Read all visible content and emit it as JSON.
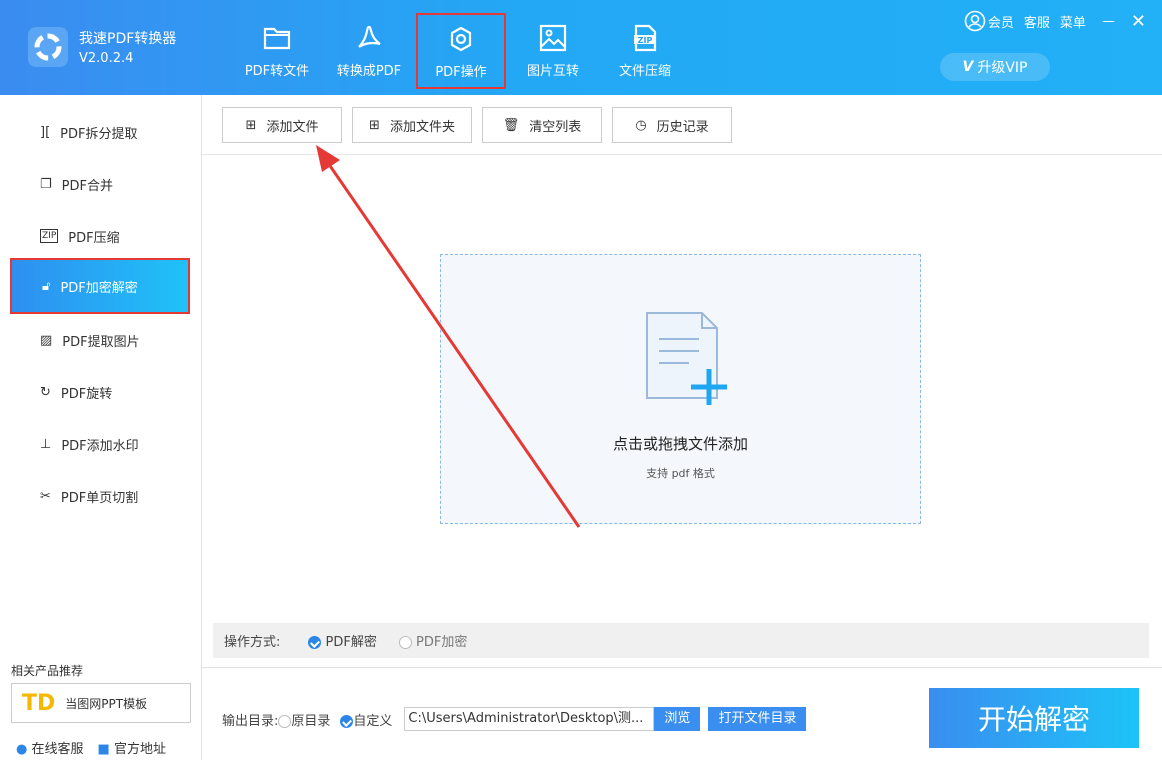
{
  "app": {
    "name": "我速PDF转换器",
    "version": "V2.0.2.4"
  },
  "nav": [
    {
      "label": "PDF转文件",
      "icon": "folder-icon"
    },
    {
      "label": "转换成PDF",
      "icon": "acrobat-icon"
    },
    {
      "label": "PDF操作",
      "icon": "gear-icon",
      "active": true
    },
    {
      "label": "图片互转",
      "icon": "image-icon"
    },
    {
      "label": "文件压缩",
      "icon": "zip-icon"
    }
  ],
  "top_right": {
    "member": "会员",
    "service": "客服",
    "menu": "菜单",
    "vip": "升级VIP"
  },
  "sidebar": {
    "items": [
      {
        "label": "PDF拆分提取"
      },
      {
        "label": "PDF合并"
      },
      {
        "label": "PDF压缩"
      },
      {
        "label": "PDF加密解密",
        "active": true
      },
      {
        "label": "PDF提取图片"
      },
      {
        "label": "PDF旋转"
      },
      {
        "label": "PDF添加水印"
      },
      {
        "label": "PDF单页切割"
      }
    ],
    "rec_title": "相关产品推荐",
    "rec_product": "当图网PPT模板",
    "online_service": "在线客服",
    "official_site": "官方地址"
  },
  "toolbar": {
    "add_file": "添加文件",
    "add_folder": "添加文件夹",
    "clear_list": "清空列表",
    "history": "历史记录"
  },
  "dropzone": {
    "title": "点击或拖拽文件添加",
    "subtitle": "支持 pdf 格式"
  },
  "options": {
    "label": "操作方式:",
    "decrypt": "PDF解密",
    "encrypt": "PDF加密",
    "selected": "decrypt"
  },
  "output": {
    "label": "输出目录:",
    "original": "原目录",
    "custom": "自定义",
    "path": "C:\\Users\\Administrator\\Desktop\\测...",
    "browse": "浏览",
    "open_dir": "打开文件目录"
  },
  "start_button": "开始解密"
}
